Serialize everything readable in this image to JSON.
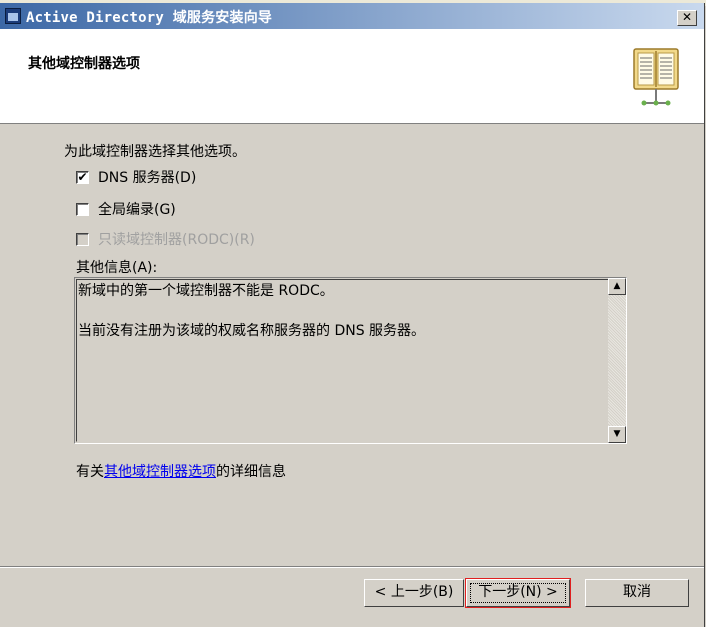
{
  "dialog": {
    "title": "Active Directory 域服务安装向导",
    "close_glyph": "✕",
    "heading": "其他域控制器选项",
    "intro": "为此域控制器选择其他选项。",
    "options": [
      {
        "label": "DNS 服务器(D)",
        "checked": true,
        "enabled": true
      },
      {
        "label": "全局编录(G)",
        "checked": false,
        "enabled": true
      },
      {
        "label": "只读域控制器(RODC)(R)",
        "checked": false,
        "enabled": false
      }
    ],
    "info_label": "其他信息(A):",
    "info_lines": [
      "新域中的第一个域控制器不能是 RODC。",
      "当前没有注册为该域的权威名称服务器的 DNS 服务器。"
    ],
    "more_info_prefix": "有关",
    "more_info_link": "其他域控制器选项",
    "more_info_suffix": "的详细信息",
    "buttons": {
      "back": "< 上一步(B)",
      "next": "下一步(N) >",
      "cancel": "取消"
    },
    "icons": {
      "window": "window-icon",
      "header": "book-icon",
      "scroll_up": "▲",
      "scroll_down": "▼",
      "check": "✔"
    }
  },
  "colors": {
    "titlebar_start": "#3c68a6",
    "titlebar_end": "#c9d9ee",
    "dialog_bg": "#d4d0c8",
    "link": "#0000ee",
    "highlight": "#e02020"
  }
}
